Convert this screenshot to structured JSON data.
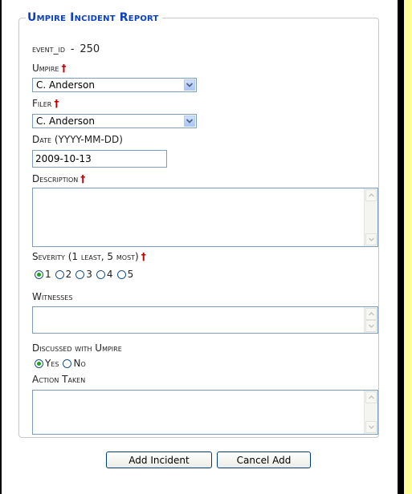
{
  "form": {
    "legend": "Umpire Incident Report",
    "event_id_label": "event_id",
    "event_id_sep": "-",
    "event_id_value": "250",
    "required_mark": "†"
  },
  "fields": {
    "umpire": {
      "label": "Umpire",
      "value": "C. Anderson"
    },
    "filer": {
      "label": "Filer",
      "value": "C. Anderson"
    },
    "date": {
      "label": "Date (YYYY-MM-DD)",
      "value": "2009-10-13"
    },
    "description": {
      "label": "Description",
      "value": ""
    },
    "severity": {
      "label": "Severity (1 least, 5 most)",
      "options": [
        "1",
        "2",
        "3",
        "4",
        "5"
      ],
      "selected": "1"
    },
    "witnesses": {
      "label": "Witnesses",
      "value": ""
    },
    "discussed": {
      "label": "Discussed with Umpire",
      "options": [
        "Yes",
        "No"
      ],
      "selected": "Yes"
    },
    "action_taken": {
      "label": "Action Taken",
      "value": ""
    }
  },
  "buttons": {
    "add": "Add Incident",
    "cancel": "Cancel Add"
  },
  "colors": {
    "page_background": "#ffff99",
    "legend": "#0a40c4",
    "required": "#c00000",
    "radio_selected": "#21a121"
  },
  "icons": {
    "select_arrow": "chevron-down-icon",
    "scroll_up": "scroll-up-arrow-icon",
    "scroll_down": "scroll-down-arrow-icon"
  }
}
